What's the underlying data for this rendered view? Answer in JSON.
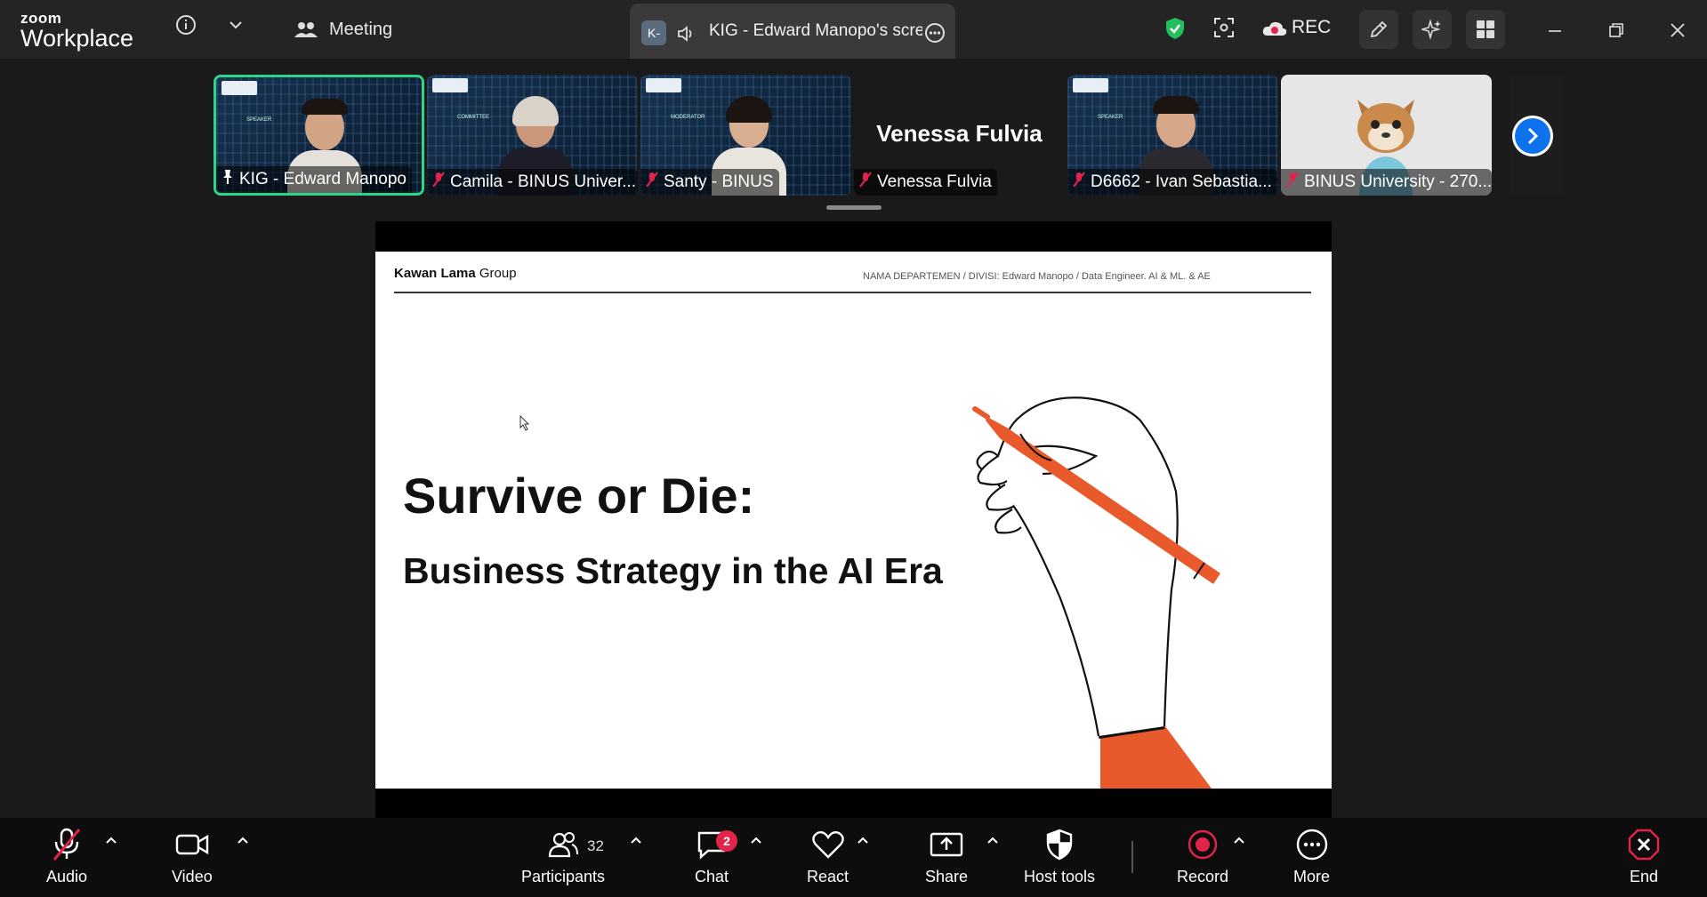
{
  "app": {
    "logo_top": "zoom",
    "logo_bottom": "Workplace"
  },
  "header": {
    "meeting_label": "Meeting",
    "share_tab_badge": "K-",
    "share_tab_title": "KIG - Edward Manopo's screen",
    "rec_label": "REC"
  },
  "participants_strip": {
    "tiles": [
      {
        "name": "KIG - Edward Manopo",
        "role": "SPEAKER",
        "mic": "pinned"
      },
      {
        "name": "Camila - BINUS Univer...",
        "role": "COMMITTEE",
        "mic": "muted"
      },
      {
        "name": "Santy - BINUS",
        "role": "MODERATOR",
        "mic": "muted"
      },
      {
        "name": "Venessa Fulvia",
        "big_name": "Venessa Fulvia",
        "mic": "muted"
      },
      {
        "name": "D6662 - Ivan Sebastia...",
        "role": "SPEAKER",
        "mic": "muted"
      },
      {
        "name": "BINUS University - 270...",
        "mic": "muted"
      }
    ]
  },
  "slide": {
    "brand_bold": "Kawan Lama",
    "brand_rest": " Group",
    "dept": "NAMA DEPARTEMEN / DIVISI: Edward Manopo / Data Engineer. AI & ML. & AE",
    "title": "Survive or Die:",
    "subtitle": "Business Strategy in the AI Era"
  },
  "toolbar": {
    "audio": "Audio",
    "video": "Video",
    "participants": "Participants",
    "participants_count": "32",
    "chat": "Chat",
    "chat_badge": "2",
    "react": "React",
    "share": "Share",
    "host_tools": "Host tools",
    "record": "Record",
    "more": "More",
    "end": "End"
  },
  "colors": {
    "accent_green": "#2fd487",
    "record_red": "#e3244a",
    "slide_orange": "#e85a2c",
    "link_blue": "#0e72ed"
  }
}
